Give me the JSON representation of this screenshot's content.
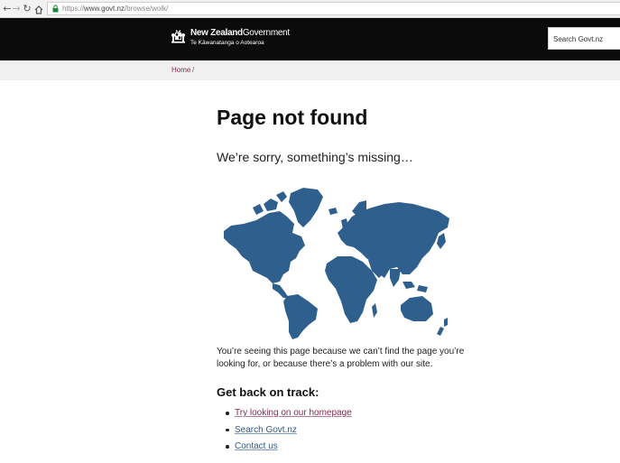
{
  "browser": {
    "url_prefix": "https://",
    "url_host": "www.govt.nz",
    "url_path": "/browse/wolk/"
  },
  "header": {
    "logo_main_bold": "New Zealand",
    "logo_main_regular": "Government",
    "logo_sub": "Te Kāwanatanga o Aotearoa",
    "search_placeholder": "Search Govt.nz"
  },
  "breadcrumb": {
    "home_label": "Home",
    "separator": "/"
  },
  "main": {
    "title": "Page not found",
    "subtitle": "We’re sorry, something’s missing…",
    "description_line1": "You’re seeing this page because we can’t find the page you’re",
    "description_line2": "looking for, or because there’s a problem with our site.",
    "track_heading": "Get back on track:",
    "links": [
      {
        "label": "Try looking on our homepage"
      },
      {
        "label": "Search Govt.nz"
      },
      {
        "label": "Contact us"
      }
    ]
  },
  "colors": {
    "header_bg": "#0b0b0b",
    "map_fill": "#2f5f8c",
    "link": "#2d5a8a",
    "visited_link": "#7d2d4f"
  }
}
